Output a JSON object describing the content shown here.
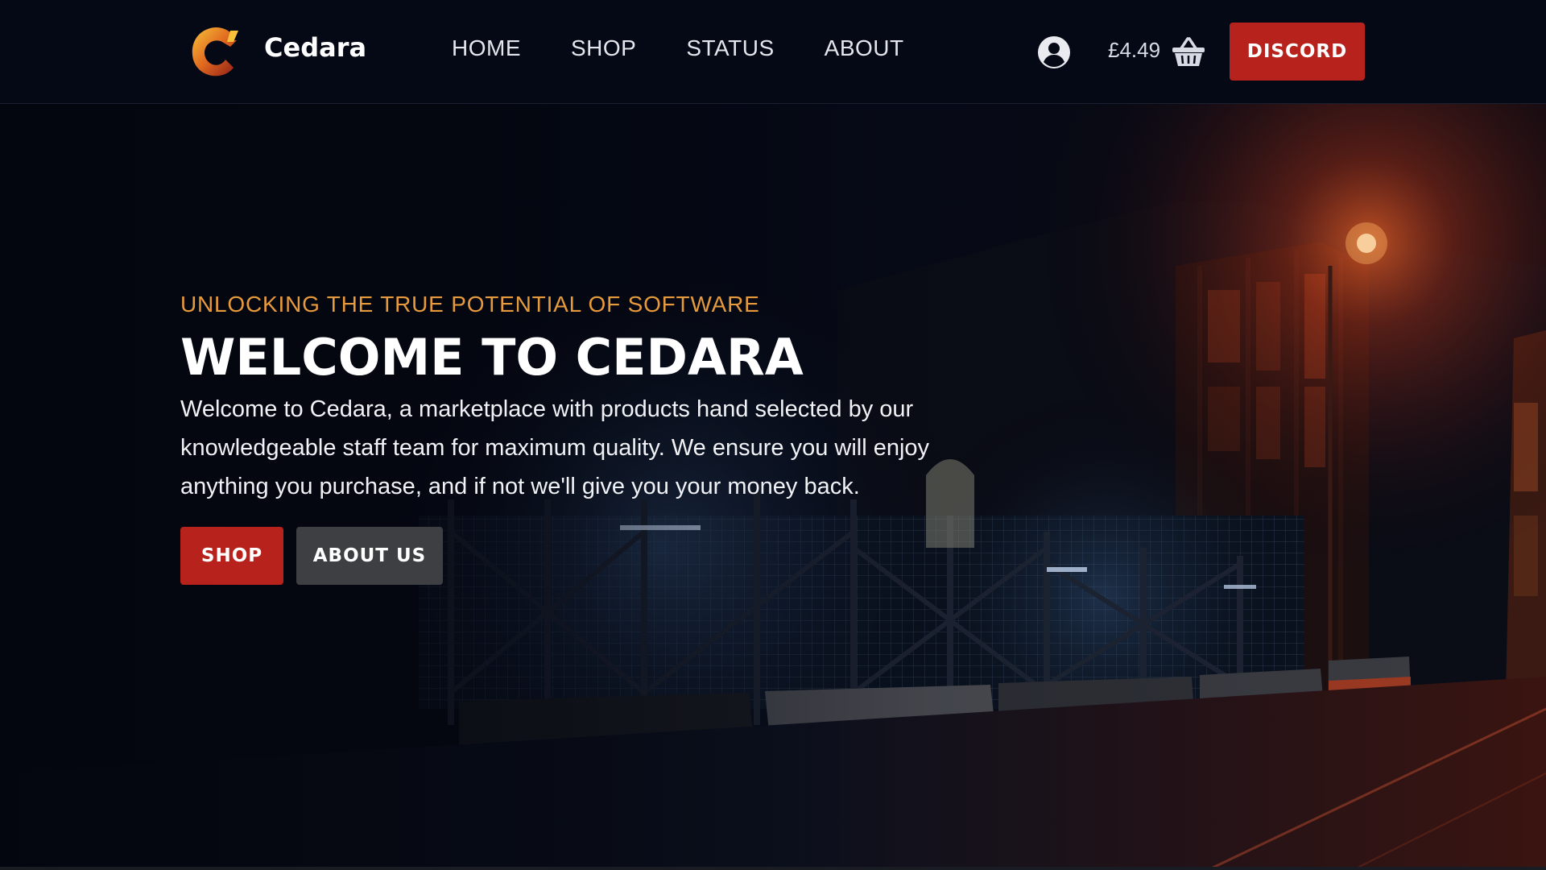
{
  "brand": {
    "name": "Cedara",
    "logo_icon": "cedara-c-logo",
    "logo_colors": [
      "#f2b230",
      "#d9531c",
      "#8c1b16"
    ]
  },
  "nav": {
    "items": [
      {
        "label": "HOME"
      },
      {
        "label": "SHOP"
      },
      {
        "label": "STATUS"
      },
      {
        "label": "ABOUT"
      }
    ]
  },
  "account": {
    "icon": "user-circle-icon"
  },
  "cart": {
    "total": "£4.49",
    "icon": "basket-icon"
  },
  "discord_button": {
    "label": "DISCORD",
    "color": "#b8221c"
  },
  "hero": {
    "tagline": "UNLOCKING THE TRUE POTENTIAL OF SOFTWARE",
    "tagline_color": "#e79a3c",
    "title": "WELCOME TO CEDARA",
    "description": "Welcome to Cedara, a marketplace with products hand selected by our knowledgeable staff team for maximum quality. We ensure you will enjoy anything you purchase, and if not we'll give you your money back.",
    "primary_button": "SHOP",
    "secondary_button": "ABOUT US"
  },
  "colors": {
    "accent": "#b8221c",
    "header_bg": "#050916",
    "secondary_button": "#3e3f43"
  }
}
